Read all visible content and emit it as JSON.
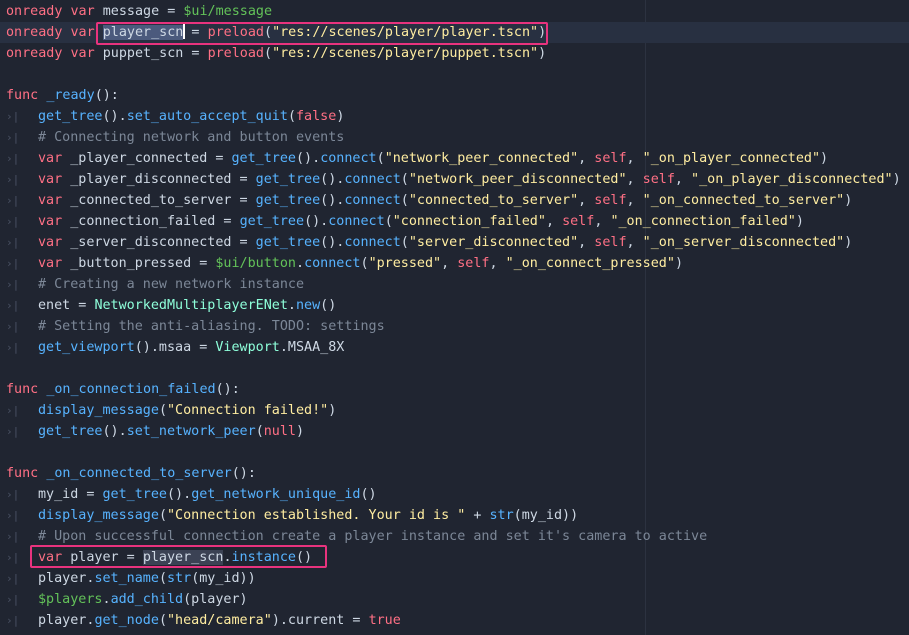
{
  "editor": {
    "language": "GDScript",
    "colors": {
      "background": "#202531",
      "keyword": "#ff7085",
      "function": "#57b3ff",
      "string": "#ffeda1",
      "comment": "#7c8797",
      "node_path": "#63c259",
      "class": "#8effda",
      "text": "#ced8e4",
      "annotation_box": "#e8337e"
    },
    "indent_icon": "tab-indent-icon",
    "lines": [
      {
        "indent": 0,
        "current": false,
        "tokens": [
          {
            "t": "onready",
            "c": "kw"
          },
          {
            "t": " ",
            "c": "plain"
          },
          {
            "t": "var",
            "c": "kw"
          },
          {
            "t": " message = ",
            "c": "plain"
          },
          {
            "t": "$ui/message",
            "c": "node"
          }
        ]
      },
      {
        "indent": 0,
        "current": true,
        "tokens": [
          {
            "t": "onready",
            "c": "kw"
          },
          {
            "t": " ",
            "c": "plain"
          },
          {
            "t": "var",
            "c": "kw"
          },
          {
            "t": " ",
            "c": "plain"
          },
          {
            "t": "player_scn",
            "c": "sel"
          },
          {
            "t": "|",
            "c": "caret"
          },
          {
            "t": " = ",
            "c": "plain"
          },
          {
            "t": "preload",
            "c": "kw"
          },
          {
            "t": "(",
            "c": "plain"
          },
          {
            "t": "\"res://scenes/player/player.tscn\"",
            "c": "str"
          },
          {
            "t": ")",
            "c": "plain"
          }
        ]
      },
      {
        "indent": 0,
        "current": false,
        "tokens": [
          {
            "t": "onready",
            "c": "kw"
          },
          {
            "t": " ",
            "c": "plain"
          },
          {
            "t": "var",
            "c": "kw"
          },
          {
            "t": " puppet_scn = ",
            "c": "plain"
          },
          {
            "t": "preload",
            "c": "kw"
          },
          {
            "t": "(",
            "c": "plain"
          },
          {
            "t": "\"res://scenes/player/puppet.tscn\"",
            "c": "str"
          },
          {
            "t": ")",
            "c": "plain"
          }
        ]
      },
      {
        "indent": 0,
        "current": false,
        "tokens": []
      },
      {
        "indent": 0,
        "current": false,
        "tokens": [
          {
            "t": "func",
            "c": "kw"
          },
          {
            "t": " ",
            "c": "plain"
          },
          {
            "t": "_ready",
            "c": "fn"
          },
          {
            "t": "():",
            "c": "plain"
          }
        ]
      },
      {
        "indent": 1,
        "current": false,
        "tokens": [
          {
            "t": "get_tree",
            "c": "fn"
          },
          {
            "t": "().",
            "c": "plain"
          },
          {
            "t": "set_auto_accept_quit",
            "c": "fn"
          },
          {
            "t": "(",
            "c": "plain"
          },
          {
            "t": "false",
            "c": "kw"
          },
          {
            "t": ")",
            "c": "plain"
          }
        ]
      },
      {
        "indent": 1,
        "current": false,
        "tokens": [
          {
            "t": "# Connecting network and button events",
            "c": "cm"
          }
        ]
      },
      {
        "indent": 1,
        "current": false,
        "tokens": [
          {
            "t": "var",
            "c": "kw"
          },
          {
            "t": " _player_connected = ",
            "c": "plain"
          },
          {
            "t": "get_tree",
            "c": "fn"
          },
          {
            "t": "().",
            "c": "plain"
          },
          {
            "t": "connect",
            "c": "fn"
          },
          {
            "t": "(",
            "c": "plain"
          },
          {
            "t": "\"network_peer_connected\"",
            "c": "str"
          },
          {
            "t": ", ",
            "c": "plain"
          },
          {
            "t": "self",
            "c": "kw"
          },
          {
            "t": ", ",
            "c": "plain"
          },
          {
            "t": "\"_on_player_connected\"",
            "c": "str"
          },
          {
            "t": ")",
            "c": "plain"
          }
        ]
      },
      {
        "indent": 1,
        "current": false,
        "tokens": [
          {
            "t": "var",
            "c": "kw"
          },
          {
            "t": " _player_disconnected = ",
            "c": "plain"
          },
          {
            "t": "get_tree",
            "c": "fn"
          },
          {
            "t": "().",
            "c": "plain"
          },
          {
            "t": "connect",
            "c": "fn"
          },
          {
            "t": "(",
            "c": "plain"
          },
          {
            "t": "\"network_peer_disconnected\"",
            "c": "str"
          },
          {
            "t": ", ",
            "c": "plain"
          },
          {
            "t": "self",
            "c": "kw"
          },
          {
            "t": ", ",
            "c": "plain"
          },
          {
            "t": "\"_on_player_disconnected\"",
            "c": "str"
          },
          {
            "t": ")",
            "c": "plain"
          }
        ]
      },
      {
        "indent": 1,
        "current": false,
        "tokens": [
          {
            "t": "var",
            "c": "kw"
          },
          {
            "t": " _connected_to_server = ",
            "c": "plain"
          },
          {
            "t": "get_tree",
            "c": "fn"
          },
          {
            "t": "().",
            "c": "plain"
          },
          {
            "t": "connect",
            "c": "fn"
          },
          {
            "t": "(",
            "c": "plain"
          },
          {
            "t": "\"connected_to_server\"",
            "c": "str"
          },
          {
            "t": ", ",
            "c": "plain"
          },
          {
            "t": "self",
            "c": "kw"
          },
          {
            "t": ", ",
            "c": "plain"
          },
          {
            "t": "\"_on_connected_to_server\"",
            "c": "str"
          },
          {
            "t": ")",
            "c": "plain"
          }
        ]
      },
      {
        "indent": 1,
        "current": false,
        "tokens": [
          {
            "t": "var",
            "c": "kw"
          },
          {
            "t": " _connection_failed = ",
            "c": "plain"
          },
          {
            "t": "get_tree",
            "c": "fn"
          },
          {
            "t": "().",
            "c": "plain"
          },
          {
            "t": "connect",
            "c": "fn"
          },
          {
            "t": "(",
            "c": "plain"
          },
          {
            "t": "\"connection_failed\"",
            "c": "str"
          },
          {
            "t": ", ",
            "c": "plain"
          },
          {
            "t": "self",
            "c": "kw"
          },
          {
            "t": ", ",
            "c": "plain"
          },
          {
            "t": "\"_on_connection_failed\"",
            "c": "str"
          },
          {
            "t": ")",
            "c": "plain"
          }
        ]
      },
      {
        "indent": 1,
        "current": false,
        "tokens": [
          {
            "t": "var",
            "c": "kw"
          },
          {
            "t": " _server_disconnected = ",
            "c": "plain"
          },
          {
            "t": "get_tree",
            "c": "fn"
          },
          {
            "t": "().",
            "c": "plain"
          },
          {
            "t": "connect",
            "c": "fn"
          },
          {
            "t": "(",
            "c": "plain"
          },
          {
            "t": "\"server_disconnected\"",
            "c": "str"
          },
          {
            "t": ", ",
            "c": "plain"
          },
          {
            "t": "self",
            "c": "kw"
          },
          {
            "t": ", ",
            "c": "plain"
          },
          {
            "t": "\"_on_server_disconnected\"",
            "c": "str"
          },
          {
            "t": ")",
            "c": "plain"
          }
        ]
      },
      {
        "indent": 1,
        "current": false,
        "tokens": [
          {
            "t": "var",
            "c": "kw"
          },
          {
            "t": " _button_pressed = ",
            "c": "plain"
          },
          {
            "t": "$ui/button",
            "c": "node"
          },
          {
            "t": ".",
            "c": "plain"
          },
          {
            "t": "connect",
            "c": "fn"
          },
          {
            "t": "(",
            "c": "plain"
          },
          {
            "t": "\"pressed\"",
            "c": "str"
          },
          {
            "t": ", ",
            "c": "plain"
          },
          {
            "t": "self",
            "c": "kw"
          },
          {
            "t": ", ",
            "c": "plain"
          },
          {
            "t": "\"_on_connect_pressed\"",
            "c": "str"
          },
          {
            "t": ")",
            "c": "plain"
          }
        ]
      },
      {
        "indent": 1,
        "current": false,
        "tokens": [
          {
            "t": "# Creating a new network instance",
            "c": "cm"
          }
        ]
      },
      {
        "indent": 1,
        "current": false,
        "tokens": [
          {
            "t": "enet = ",
            "c": "plain"
          },
          {
            "t": "NetworkedMultiplayerENet",
            "c": "cls"
          },
          {
            "t": ".",
            "c": "plain"
          },
          {
            "t": "new",
            "c": "fn"
          },
          {
            "t": "()",
            "c": "plain"
          }
        ]
      },
      {
        "indent": 1,
        "current": false,
        "tokens": [
          {
            "t": "# Setting the anti-aliasing. TODO: settings",
            "c": "cm"
          }
        ]
      },
      {
        "indent": 1,
        "current": false,
        "tokens": [
          {
            "t": "get_viewport",
            "c": "fn"
          },
          {
            "t": "().msaa = ",
            "c": "plain"
          },
          {
            "t": "Viewport",
            "c": "cls"
          },
          {
            "t": ".MSAA_8X",
            "c": "plain"
          }
        ]
      },
      {
        "indent": 0,
        "current": false,
        "tokens": []
      },
      {
        "indent": 0,
        "current": false,
        "tokens": [
          {
            "t": "func",
            "c": "kw"
          },
          {
            "t": " ",
            "c": "plain"
          },
          {
            "t": "_on_connection_failed",
            "c": "fn"
          },
          {
            "t": "():",
            "c": "plain"
          }
        ]
      },
      {
        "indent": 1,
        "current": false,
        "tokens": [
          {
            "t": "display_message",
            "c": "fn"
          },
          {
            "t": "(",
            "c": "plain"
          },
          {
            "t": "\"Connection failed!\"",
            "c": "str"
          },
          {
            "t": ")",
            "c": "plain"
          }
        ]
      },
      {
        "indent": 1,
        "current": false,
        "tokens": [
          {
            "t": "get_tree",
            "c": "fn"
          },
          {
            "t": "().",
            "c": "plain"
          },
          {
            "t": "set_network_peer",
            "c": "fn"
          },
          {
            "t": "(",
            "c": "plain"
          },
          {
            "t": "null",
            "c": "kw"
          },
          {
            "t": ")",
            "c": "plain"
          }
        ]
      },
      {
        "indent": 0,
        "current": false,
        "tokens": []
      },
      {
        "indent": 0,
        "current": false,
        "tokens": [
          {
            "t": "func",
            "c": "kw"
          },
          {
            "t": " ",
            "c": "plain"
          },
          {
            "t": "_on_connected_to_server",
            "c": "fn"
          },
          {
            "t": "():",
            "c": "plain"
          }
        ]
      },
      {
        "indent": 1,
        "current": false,
        "tokens": [
          {
            "t": "my_id = ",
            "c": "plain"
          },
          {
            "t": "get_tree",
            "c": "fn"
          },
          {
            "t": "().",
            "c": "plain"
          },
          {
            "t": "get_network_unique_id",
            "c": "fn"
          },
          {
            "t": "()",
            "c": "plain"
          }
        ]
      },
      {
        "indent": 1,
        "current": false,
        "tokens": [
          {
            "t": "display_message",
            "c": "fn"
          },
          {
            "t": "(",
            "c": "plain"
          },
          {
            "t": "\"Connection established. Your id is \"",
            "c": "str"
          },
          {
            "t": " + ",
            "c": "plain"
          },
          {
            "t": "str",
            "c": "fn"
          },
          {
            "t": "(my_id))",
            "c": "plain"
          }
        ]
      },
      {
        "indent": 1,
        "current": false,
        "tokens": [
          {
            "t": "# Upon successful connection create a player instance and set it's camera to active",
            "c": "cm"
          }
        ]
      },
      {
        "indent": 1,
        "current": false,
        "tokens": [
          {
            "t": "var",
            "c": "kw"
          },
          {
            "t": " player = ",
            "c": "plain"
          },
          {
            "t": "player_scn",
            "c": "hl"
          },
          {
            "t": ".",
            "c": "plain"
          },
          {
            "t": "instance",
            "c": "fn"
          },
          {
            "t": "()",
            "c": "plain"
          }
        ]
      },
      {
        "indent": 1,
        "current": false,
        "tokens": [
          {
            "t": "player.",
            "c": "plain"
          },
          {
            "t": "set_name",
            "c": "fn"
          },
          {
            "t": "(",
            "c": "plain"
          },
          {
            "t": "str",
            "c": "fn"
          },
          {
            "t": "(my_id))",
            "c": "plain"
          }
        ]
      },
      {
        "indent": 1,
        "current": false,
        "tokens": [
          {
            "t": "$players",
            "c": "node"
          },
          {
            "t": ".",
            "c": "plain"
          },
          {
            "t": "add_child",
            "c": "fn"
          },
          {
            "t": "(player)",
            "c": "plain"
          }
        ]
      },
      {
        "indent": 1,
        "current": false,
        "tokens": [
          {
            "t": "player.",
            "c": "plain"
          },
          {
            "t": "get_node",
            "c": "fn"
          },
          {
            "t": "(",
            "c": "plain"
          },
          {
            "t": "\"head/camera\"",
            "c": "str"
          },
          {
            "t": ").current = ",
            "c": "plain"
          },
          {
            "t": "true",
            "c": "kw"
          }
        ]
      }
    ]
  }
}
